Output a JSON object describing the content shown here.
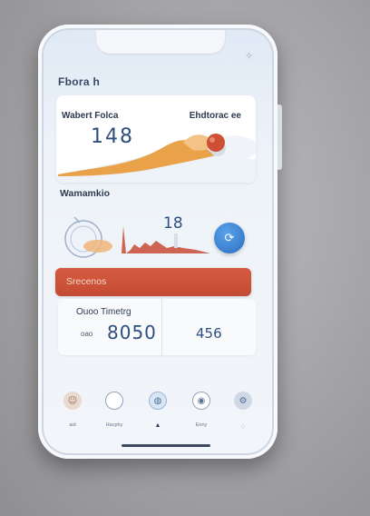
{
  "app": {
    "title": "Fbora h"
  },
  "card_top": {
    "left_label": "Wabert Folca",
    "right_label": "Ehdtorac ee",
    "value": "148"
  },
  "section2": {
    "title": "Wamamkio",
    "value": "18"
  },
  "banner": {
    "label": "Srecenos"
  },
  "card_bottom": {
    "label": "Ouoo Timetrg",
    "small": "oao",
    "value1": "8050",
    "value2": "456"
  },
  "tabs": [
    {
      "label": "aid",
      "icon": "face-icon"
    },
    {
      "label": "Hacphy",
      "icon": "ring-icon"
    },
    {
      "label": "",
      "icon": "globe-icon"
    },
    {
      "label": "Enny",
      "icon": "target-icon"
    },
    {
      "label": "",
      "icon": "settings-icon"
    }
  ],
  "colors": {
    "accent_blue": "#2b6fc2",
    "banner_red": "#c44b33",
    "wave_orange": "#e9a24a",
    "chart_red": "#c9553f",
    "text_dark": "#2f3a52"
  }
}
